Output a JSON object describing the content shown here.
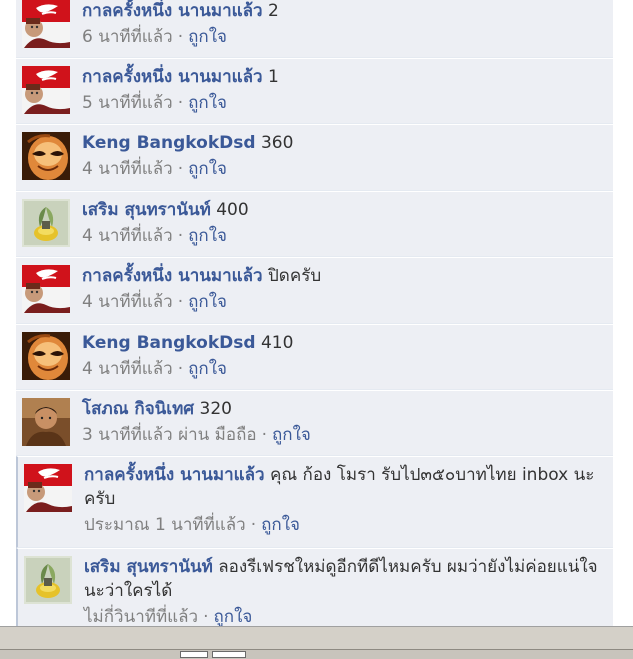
{
  "comments": [
    {
      "author": "กาลครั้งหนึ่ง นานมาแล้ว",
      "text": "2",
      "time": "6 นาทีที่แล้ว",
      "via": "",
      "like": "ถูกใจ",
      "avatar": "coca-cola-avatar",
      "highlight": false,
      "height": 66
    },
    {
      "author": "กาลครั้งหนึ่ง นานมาแล้ว",
      "text": "1",
      "time": "5 นาทีที่แล้ว",
      "via": "",
      "like": "ถูกใจ",
      "avatar": "coca-cola-avatar",
      "highlight": false,
      "height": 66
    },
    {
      "author": "Keng BangkokDsd",
      "text": "360",
      "time": "4 นาทีที่แล้ว",
      "via": "",
      "like": "ถูกใจ",
      "avatar": "mask-avatar",
      "highlight": false,
      "height": 67
    },
    {
      "author": "เสริม สุนทรานันท์",
      "text": "400",
      "time": "4 นาทีที่แล้ว",
      "via": "",
      "like": "ถูกใจ",
      "avatar": "plant-avatar",
      "highlight": false,
      "height": 66
    },
    {
      "author": "กาลครั้งหนึ่ง นานมาแล้ว",
      "text": "ปิดครับ",
      "time": "4 นาทีที่แล้ว",
      "via": "",
      "like": "ถูกใจ",
      "avatar": "coca-cola-avatar",
      "highlight": false,
      "height": 67
    },
    {
      "author": "Keng BangkokDsd",
      "text": "410",
      "time": "4 นาทีที่แล้ว",
      "via": "",
      "like": "ถูกใจ",
      "avatar": "mask-avatar",
      "highlight": false,
      "height": 66
    },
    {
      "author": "โสภณ กิจนิเทศ",
      "text": "320",
      "time": "3 นาทีที่แล้ว",
      "via": "ผ่าน มือถือ",
      "like": "ถูกใจ",
      "avatar": "person-avatar",
      "highlight": false,
      "height": 66
    },
    {
      "author": "กาลครั้งหนึ่ง นานมาแล้ว",
      "text": "คุณ ก้อง โมรา รับไป๓๕๐บาทไทย inbox นะครับ",
      "time": "ประมาณ 1 นาทีที่แล้ว",
      "via": "",
      "like": "ถูกใจ",
      "avatar": "coca-cola-avatar",
      "highlight": true,
      "height": 92
    },
    {
      "author": "เสริม สุนทรานันท์",
      "text": "ลองรีเฟรชใหม่ดูอีกทีดีไหมครับ ผมว่ายังไม่ค่อยแน่ใจนะว่าใครได้",
      "time": "ไม่กี่วินาทีที่แล้ว",
      "via": "",
      "like": "ถูกใจ",
      "avatar": "plant-avatar",
      "highlight": true,
      "height": 92
    }
  ],
  "separator": "·",
  "colors": {
    "comment_bg": "#edeff4",
    "link": "#3b5998",
    "meta": "#808080",
    "text": "#333333",
    "bottom_bar": "#d4d0c8"
  }
}
